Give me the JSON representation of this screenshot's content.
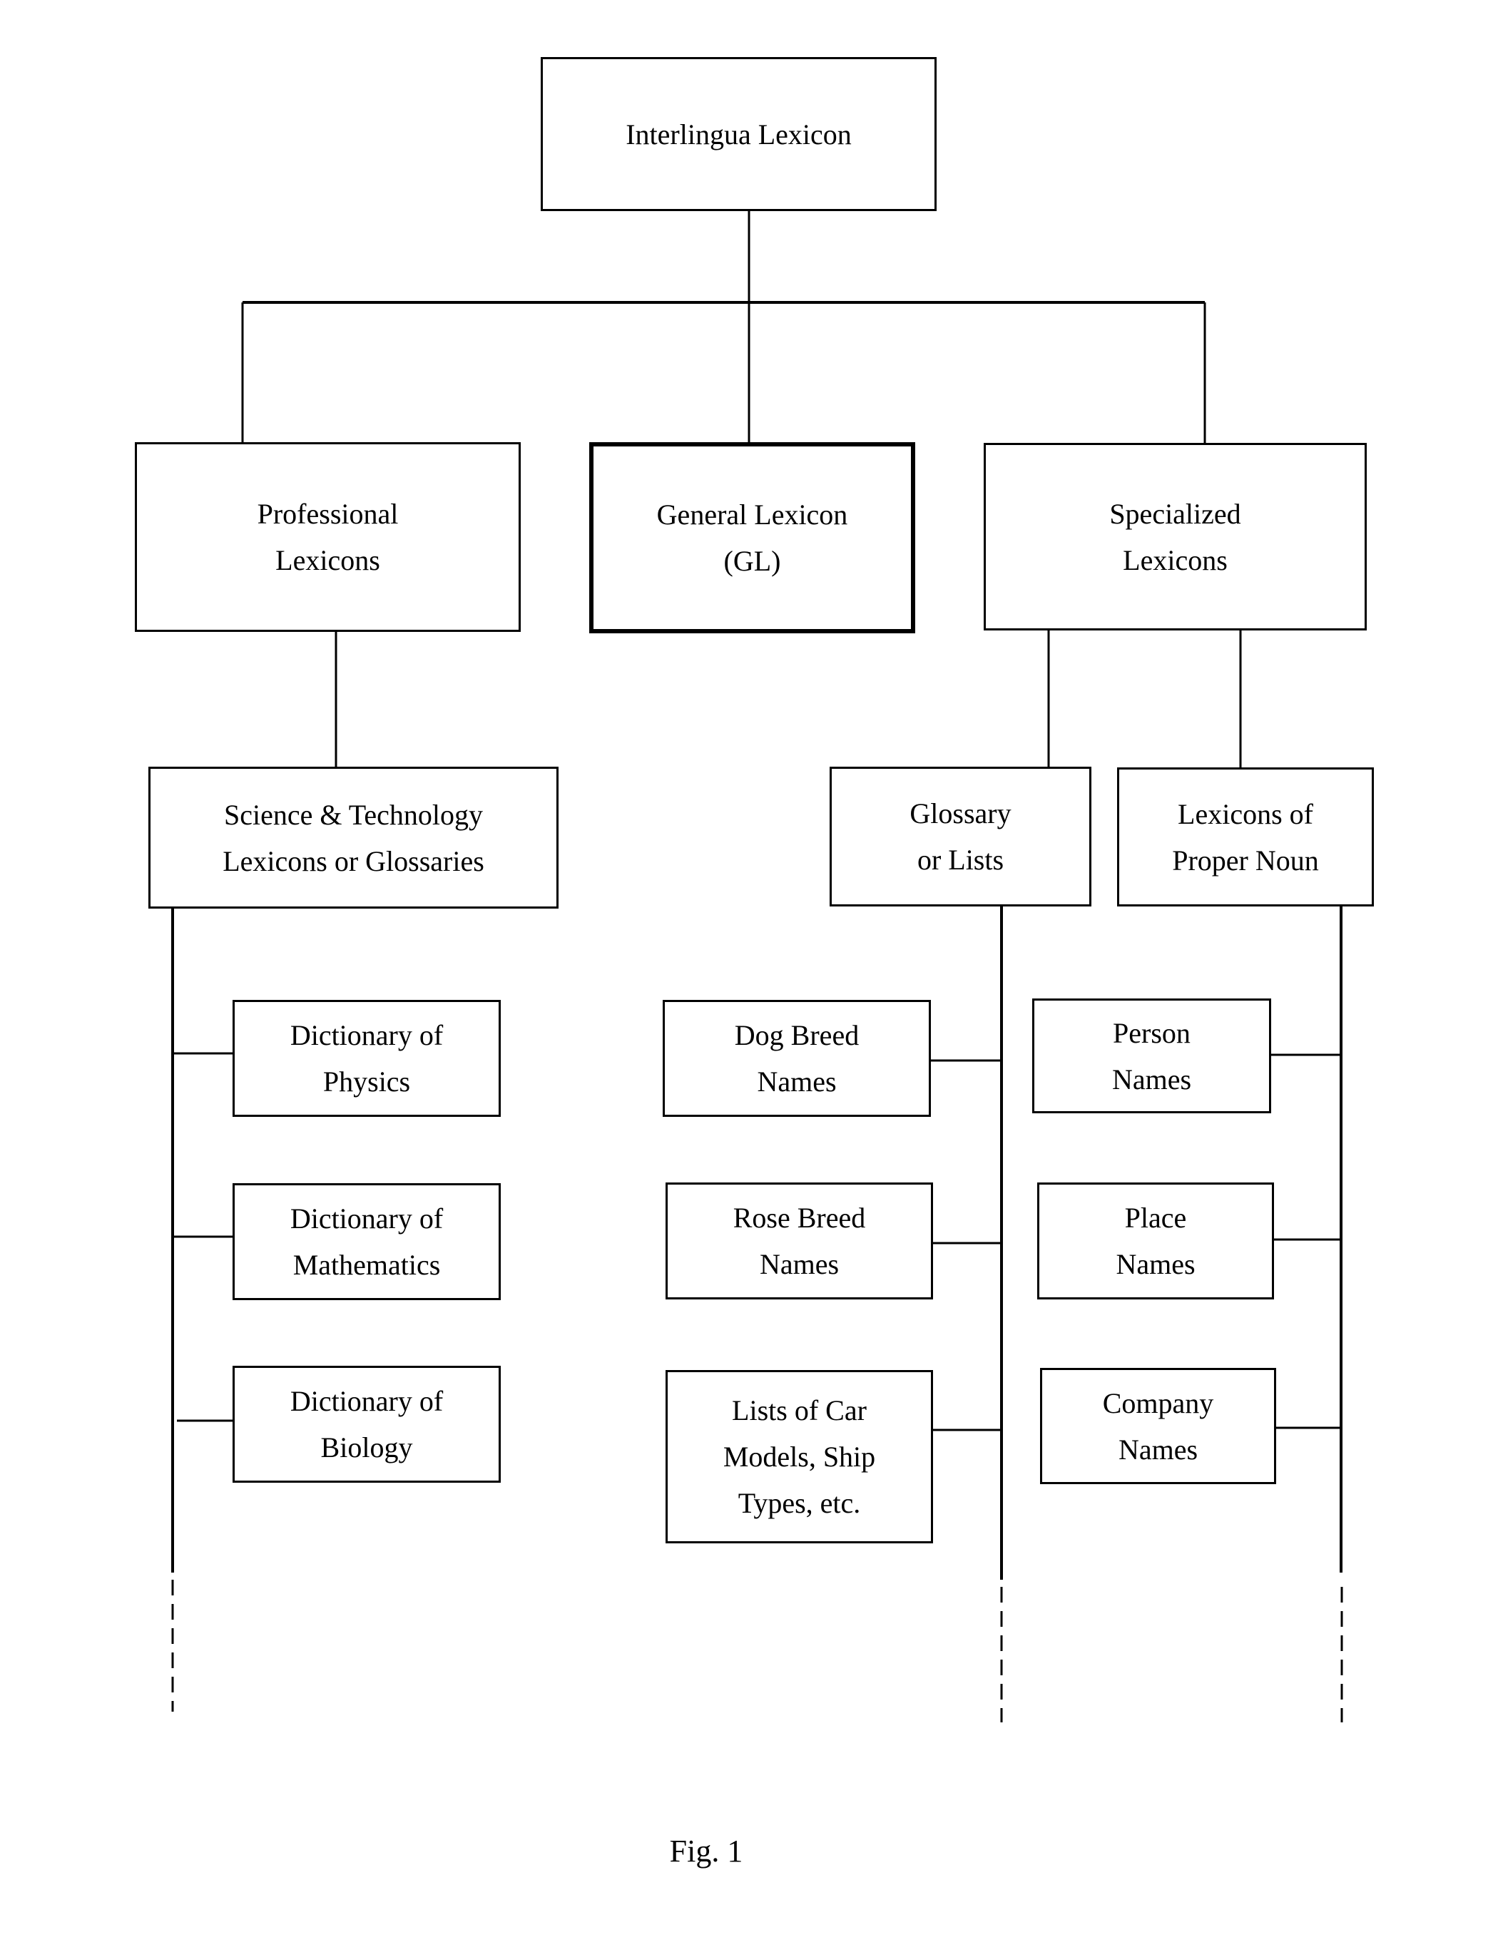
{
  "diagram": {
    "root": {
      "id": "interlingua-lexicon",
      "label": "Interlingua Lexicon"
    },
    "level1": [
      {
        "id": "professional-lexicons",
        "label": "Professional\nLexicons"
      },
      {
        "id": "general-lexicon",
        "label": "General Lexicon\n(GL)",
        "emphasized": true
      },
      {
        "id": "specialized-lexicons",
        "label": "Specialized\nLexicons"
      }
    ],
    "level2": [
      {
        "id": "sci-tech",
        "parent": "professional-lexicons",
        "label": "Science & Technology\nLexicons or Glossaries"
      },
      {
        "id": "glossary-lists",
        "parent": "specialized-lexicons",
        "label": "Glossary\nor Lists"
      },
      {
        "id": "proper-noun",
        "parent": "specialized-lexicons",
        "label": "Lexicons of\nProper Noun"
      }
    ],
    "level3": [
      {
        "id": "physics",
        "parent": "sci-tech",
        "label": "Dictionary of\nPhysics"
      },
      {
        "id": "mathematics",
        "parent": "sci-tech",
        "label": "Dictionary of\nMathematics"
      },
      {
        "id": "biology",
        "parent": "sci-tech",
        "label": "Dictionary of\nBiology"
      },
      {
        "id": "dog-breed",
        "parent": "glossary-lists",
        "label": "Dog Breed\nNames"
      },
      {
        "id": "rose-breed",
        "parent": "glossary-lists",
        "label": "Rose Breed\nNames"
      },
      {
        "id": "car-ship",
        "parent": "glossary-lists",
        "label": "Lists of Car\nModels, Ship\nTypes, etc."
      },
      {
        "id": "person-names",
        "parent": "proper-noun",
        "label": "Person\nNames"
      },
      {
        "id": "place-names",
        "parent": "proper-noun",
        "label": "Place\nNames"
      },
      {
        "id": "company-names",
        "parent": "proper-noun",
        "label": "Company\nNames"
      }
    ],
    "continuation": "dashed lines indicate further items",
    "caption": "Fig. 1"
  }
}
